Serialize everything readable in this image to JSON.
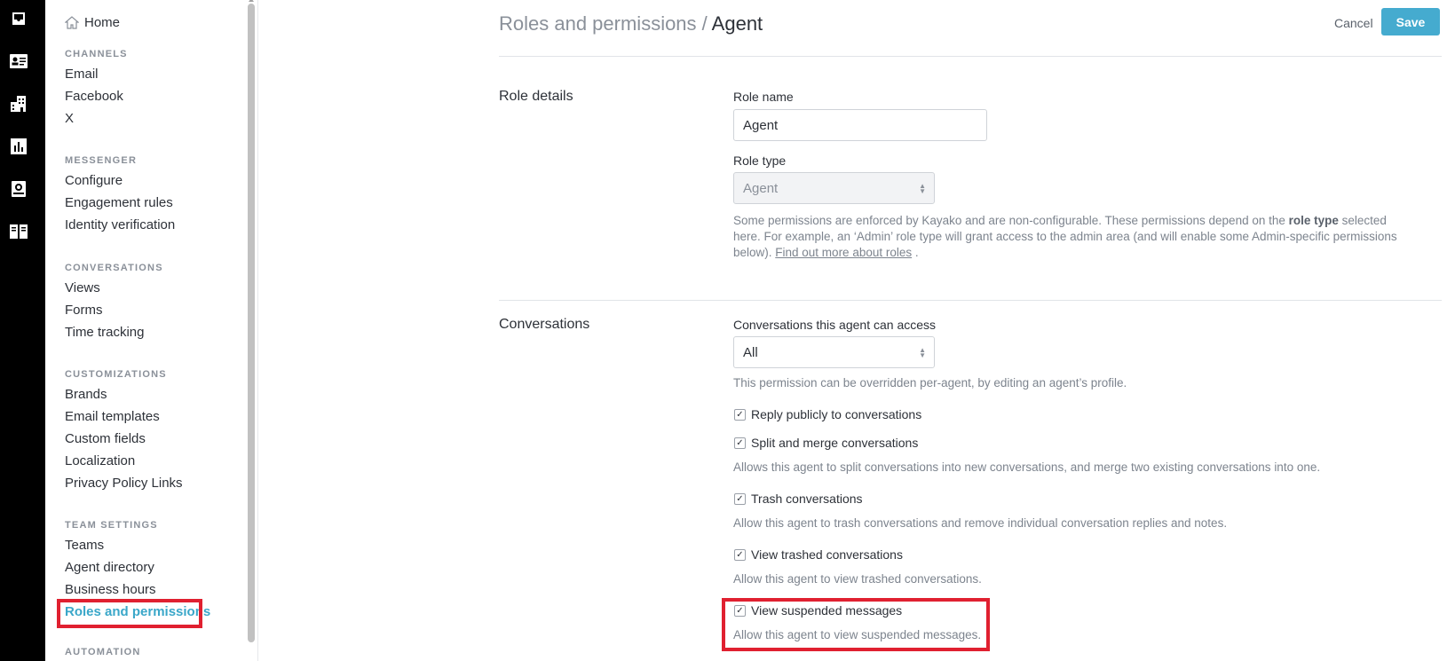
{
  "rail": {
    "icons": [
      "inbox-icon",
      "contact-card-icon",
      "organization-icon",
      "insights-icon",
      "helpcenter-icon",
      "guides-icon"
    ]
  },
  "sidebar": {
    "home": "Home",
    "sections": [
      {
        "title": "CHANNELS",
        "items": [
          "Email",
          "Facebook",
          "X"
        ]
      },
      {
        "title": "MESSENGER",
        "items": [
          "Configure",
          "Engagement rules",
          "Identity verification"
        ]
      },
      {
        "title": "CONVERSATIONS",
        "items": [
          "Views",
          "Forms",
          "Time tracking"
        ]
      },
      {
        "title": "CUSTOMIZATIONS",
        "items": [
          "Brands",
          "Email templates",
          "Custom fields",
          "Localization",
          "Privacy Policy Links"
        ]
      },
      {
        "title": "TEAM SETTINGS",
        "items": [
          "Teams",
          "Agent directory",
          "Business hours",
          "Roles and permissions"
        ]
      },
      {
        "title": "AUTOMATION",
        "items": []
      }
    ],
    "active_item": "Roles and permissions"
  },
  "header": {
    "crumb_parent": "Roles and permissions",
    "crumb_sep": " / ",
    "crumb_current": "Agent",
    "cancel_label": "Cancel",
    "save_label": "Save"
  },
  "role_details": {
    "title": "Role details",
    "role_name_label": "Role name",
    "role_name_value": "Agent",
    "role_type_label": "Role type",
    "role_type_value": "Agent",
    "help_prefix": "Some permissions are enforced by Kayako and are non-configurable. These permissions depend on the ",
    "help_bold": "role type",
    "help_mid": " selected here. For example, an ‘Admin’ role type will grant access to the admin area (and will enable some Admin-specific permissions below). ",
    "help_link": "Find out more about roles",
    "help_suffix": " ."
  },
  "conversations": {
    "title": "Conversations",
    "access_label": "Conversations this agent can access",
    "access_value": "All",
    "access_help": "This permission can be overridden per-agent, by editing an agent’s profile.",
    "permissions": [
      {
        "label": "Reply publicly to conversations",
        "checked": true,
        "help": ""
      },
      {
        "label": "Split and merge conversations",
        "checked": true,
        "help": "Allows this agent to split conversations into new conversations, and merge two existing conversations into one."
      },
      {
        "label": "Trash conversations",
        "checked": true,
        "help": "Allow this agent to trash conversations and remove individual conversation replies and notes."
      },
      {
        "label": "View trashed conversations",
        "checked": true,
        "help": "Allow this agent to view trashed conversations."
      },
      {
        "label": "View suspended messages",
        "checked": true,
        "help": "Allow this agent to view suspended messages."
      }
    ]
  },
  "colors": {
    "accent": "#45abcf",
    "highlight": "#e02030",
    "rail": "#000000"
  }
}
